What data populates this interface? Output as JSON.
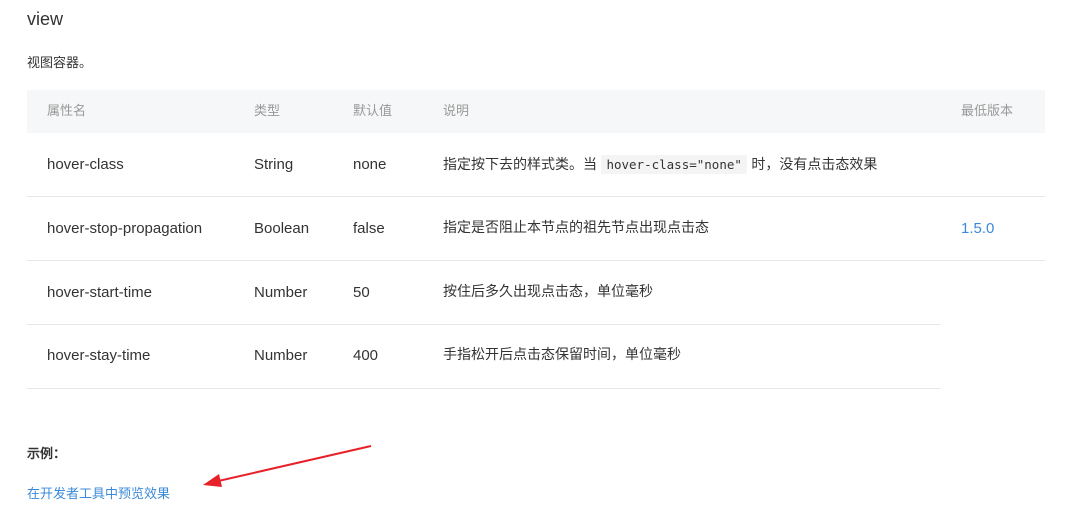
{
  "title": "view",
  "description": "视图容器。",
  "table": {
    "headers": [
      "属性名",
      "类型",
      "默认值",
      "说明",
      "最低版本"
    ],
    "rows": [
      {
        "name": "hover-class",
        "type": "String",
        "default": "none",
        "desc_pre": "指定按下去的样式类。当 ",
        "desc_code": "hover-class=\"none\"",
        "desc_post": " 时，没有点击态效果",
        "version": ""
      },
      {
        "name": "hover-stop-propagation",
        "type": "Boolean",
        "default": "false",
        "desc": "指定是否阻止本节点的祖先节点出现点击态",
        "version": "1.5.0"
      },
      {
        "name": "hover-start-time",
        "type": "Number",
        "default": "50",
        "desc": "按住后多久出现点击态，单位毫秒",
        "version": ""
      },
      {
        "name": "hover-stay-time",
        "type": "Number",
        "default": "400",
        "desc": "手指松开后点击态保留时间，单位毫秒",
        "version": ""
      }
    ]
  },
  "example_label": "示例：",
  "preview_link": "在开发者工具中预览效果",
  "colors": {
    "link": "#3b8ad9",
    "arrow": "#e8202a",
    "header_bg": "#f6f7f8"
  }
}
